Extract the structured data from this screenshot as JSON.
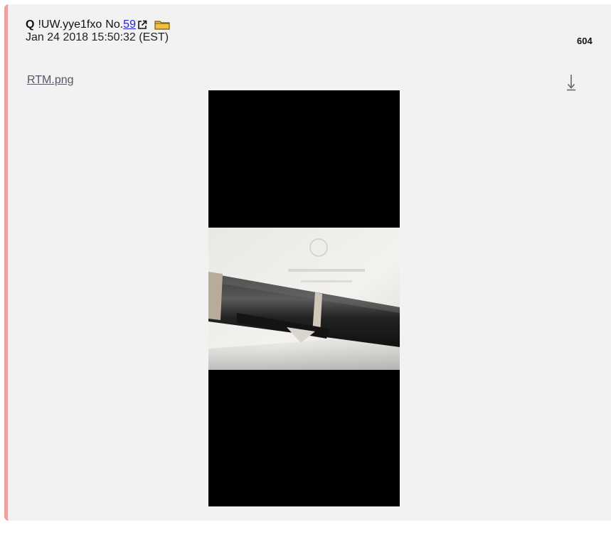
{
  "post": {
    "author": "Q",
    "tripcode": "!UW.yye1fxo",
    "number_prefix": "No.",
    "number": "59",
    "date": "Jan 24 2018 15:50:32 (EST)",
    "count": "604",
    "filename": "RTM.png"
  },
  "icons": {
    "external_link": "external-link-icon",
    "folder": "folder-icon",
    "download": "download-arrow-icon"
  },
  "colors": {
    "post_background": "#f2f2f2",
    "accent_border": "#f0a0a0",
    "link": "#2222dd",
    "folder": "#f0c040"
  }
}
